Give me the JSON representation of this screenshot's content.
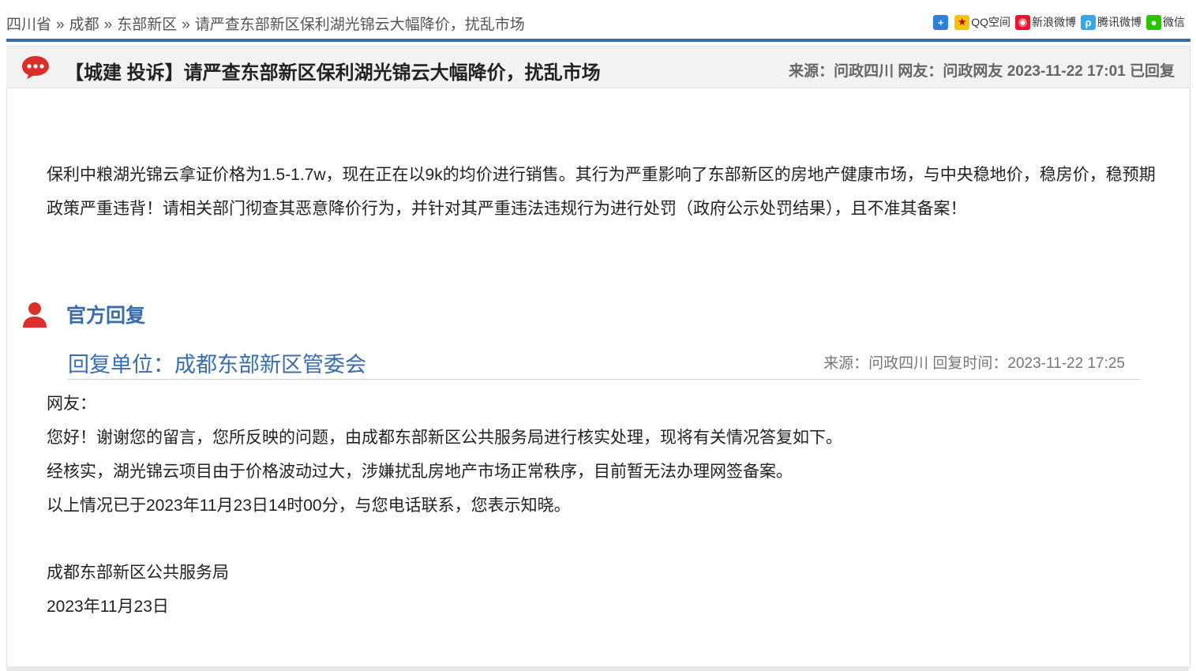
{
  "breadcrumb": {
    "items": [
      "四川省",
      "成都",
      "东部新区"
    ],
    "separator": "»",
    "current": "请严查东部新区保利湖光锦云大幅降价，扰乱市场"
  },
  "share": {
    "items": [
      {
        "label": "",
        "icon": "share-plus-icon"
      },
      {
        "label": "QQ空间",
        "icon": "qzone-icon"
      },
      {
        "label": "新浪微博",
        "icon": "sina-weibo-icon"
      },
      {
        "label": "腾讯微博",
        "icon": "tencent-weibo-icon"
      },
      {
        "label": "微信",
        "icon": "wechat-icon"
      }
    ]
  },
  "post": {
    "title": "【城建 投诉】请严查东部新区保利湖光锦云大幅降价，扰乱市场",
    "meta": "来源：问政四川 网友：问政网友  2023-11-22 17:01 已回复",
    "content": "保利中粮湖光锦云拿证价格为1.5-1.7w，现在正在以9k的均价进行销售。其行为严重影响了东部新区的房地产健康市场，与中央稳地价，稳房价，稳预期政策严重违背！请相关部门彻查其恶意降价行为，并针对其严重违法违规行为进行处罚（政府公示处罚结果），且不准其备案！"
  },
  "reply": {
    "heading": "官方回复",
    "unit": "回复单位：成都东部新区管委会",
    "meta": "来源：问政四川 回复时间：2023-11-22 17:25",
    "lines": [
      "网友：",
      "您好！谢谢您的留言，您所反映的问题，由成都东部新区公共服务局进行核实处理，现将有关情况答复如下。",
      "经核实，湖光锦云项目由于价格波动过大，涉嫌扰乱房地产市场正常秩序，目前暂无法办理网签备案。",
      "以上情况已于2023年11月23日14时00分，与您电话联系，您表示知晓。"
    ],
    "signature": "成都东部新区公共服务局",
    "date": "2023年11月23日"
  },
  "colors": {
    "accent": "#3a6cac",
    "icon_red": "#d9302b"
  }
}
